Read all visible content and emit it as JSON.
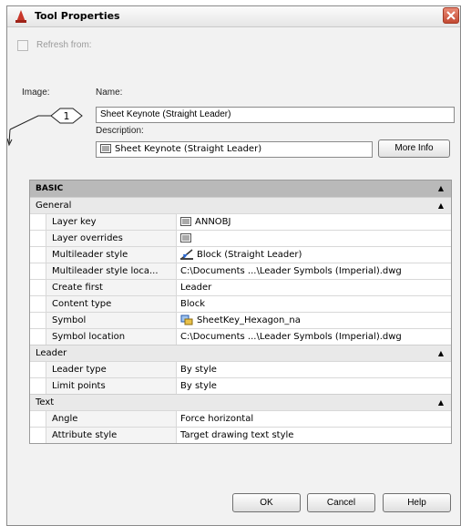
{
  "window": {
    "title": "Tool Properties",
    "close_icon": "close-icon",
    "app_icon": "autocad-icon"
  },
  "refresh": {
    "label": "Refresh from:",
    "checked": false,
    "enabled": false
  },
  "form": {
    "image_label": "Image:",
    "name_label": "Name:",
    "name_value": "Sheet Keynote (Straight Leader)",
    "description_label": "Description:",
    "description_value": "Sheet Keynote (Straight Leader)",
    "preview_number": "1",
    "more_info_label": "More Info"
  },
  "grid": {
    "category": "BASIC",
    "sections": [
      {
        "name": "General",
        "rows": [
          {
            "name": "Layer key",
            "value": "ANNOBJ",
            "icon": "layer-icon"
          },
          {
            "name": "Layer overrides",
            "value": "",
            "icon": "layer-icon"
          },
          {
            "name": "Multileader style",
            "value": "Block (Straight Leader)",
            "icon": "multileader-icon"
          },
          {
            "name": "Multileader style loca...",
            "value": "C:\\Documents ...\\Leader Symbols (Imperial).dwg",
            "icon": ""
          },
          {
            "name": "Create first",
            "value": "Leader",
            "icon": ""
          },
          {
            "name": "Content type",
            "value": "Block",
            "icon": ""
          },
          {
            "name": "Symbol",
            "value": "SheetKey_Hexagon_na",
            "icon": "block-symbol-icon"
          },
          {
            "name": "Symbol location",
            "value": "C:\\Documents ...\\Leader Symbols (Imperial).dwg",
            "icon": ""
          }
        ]
      },
      {
        "name": "Leader",
        "rows": [
          {
            "name": "Leader type",
            "value": "By style",
            "icon": ""
          },
          {
            "name": "Limit points",
            "value": "By style",
            "icon": ""
          }
        ]
      },
      {
        "name": "Text",
        "rows": [
          {
            "name": "Angle",
            "value": "Force horizontal",
            "icon": ""
          },
          {
            "name": "Attribute style",
            "value": "Target drawing text style",
            "icon": ""
          }
        ]
      }
    ]
  },
  "buttons": {
    "ok": "OK",
    "cancel": "Cancel",
    "help": "Help"
  }
}
